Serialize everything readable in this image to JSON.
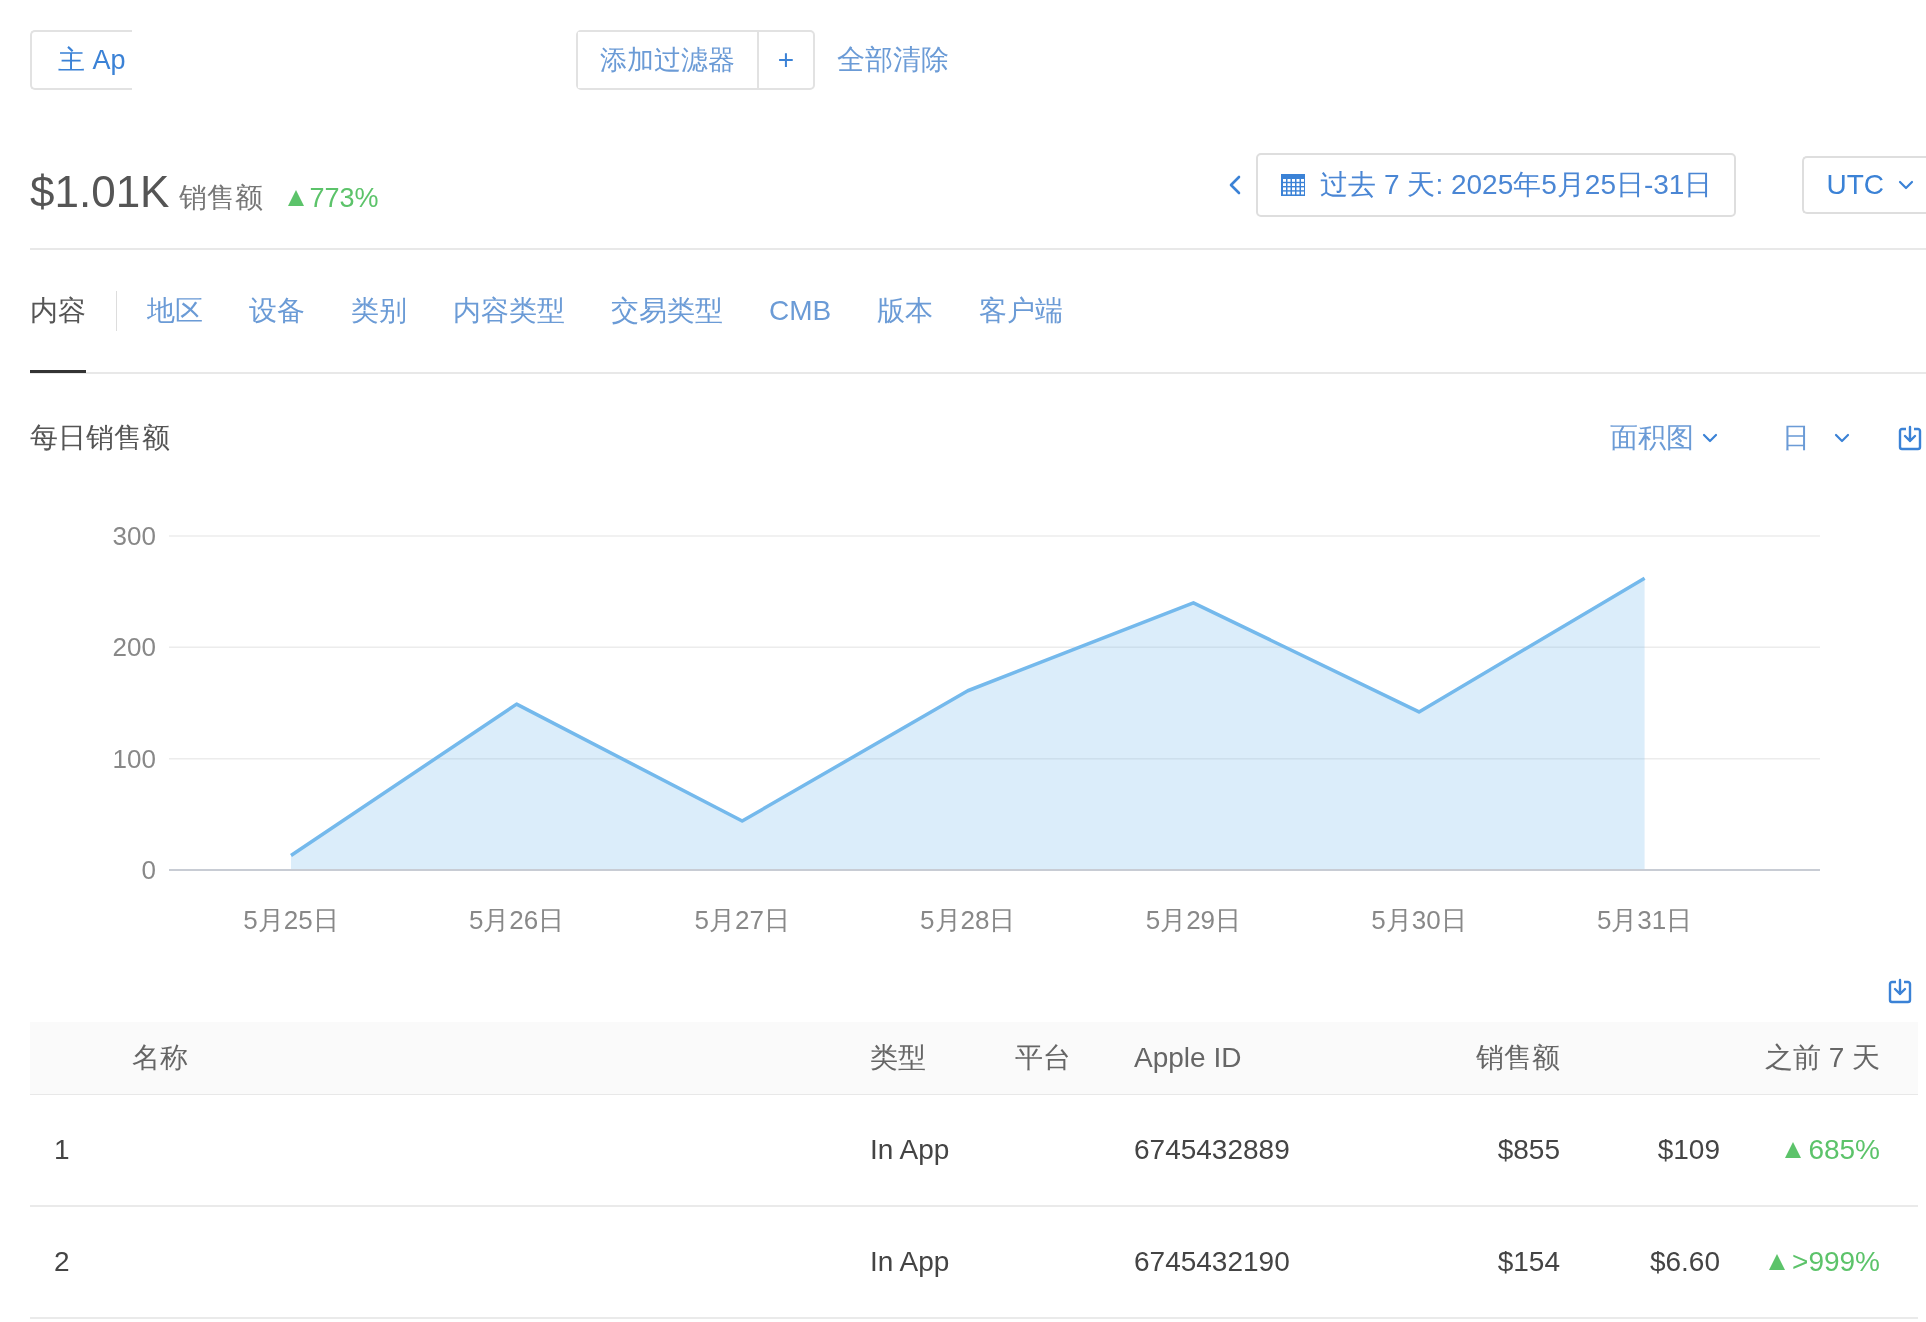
{
  "filter_bar": {
    "app_filter": "主 Ap",
    "add_filter": "添加过滤器",
    "add_icon": "+",
    "clear_all": "全部清除"
  },
  "summary": {
    "total": "$1.01K",
    "label": "销售额",
    "change": "773%",
    "rising": true
  },
  "date_range": {
    "label": "过去 7 天: 2025年5月25日-31日"
  },
  "timezone": {
    "value": "UTC"
  },
  "tabs": [
    {
      "label": "内容",
      "selected": true
    },
    {
      "label": "地区",
      "selected": false
    },
    {
      "label": "设备",
      "selected": false
    },
    {
      "label": "类别",
      "selected": false
    },
    {
      "label": "内容类型",
      "selected": false
    },
    {
      "label": "交易类型",
      "selected": false
    },
    {
      "label": "CMB",
      "selected": false
    },
    {
      "label": "版本",
      "selected": false
    },
    {
      "label": "客户端",
      "selected": false
    }
  ],
  "chart_panel": {
    "title": "每日销售额",
    "chart_type": "面积图",
    "interval": "日",
    "chart_data": {
      "type": "area",
      "categories": [
        "5月25日",
        "5月26日",
        "5月27日",
        "5月28日",
        "5月29日",
        "5月30日",
        "5月31日"
      ],
      "series": [
        {
          "color": "#74b9ec",
          "values": [
            13,
            149,
            44,
            161,
            240,
            142,
            262
          ]
        }
      ],
      "ylim": [
        0,
        300
      ],
      "yticks": [
        0,
        100,
        200,
        300
      ]
    }
  },
  "table": {
    "columns": [
      "名称",
      "类型",
      "平台",
      "Apple ID",
      "销售额",
      "之前 7 天"
    ],
    "rows": [
      {
        "rank": "1",
        "type": "In App",
        "apple_id": "6745432889",
        "sales": "$855",
        "previous": "$109",
        "change": "685%",
        "rising": true
      },
      {
        "rank": "2",
        "type": "In App",
        "apple_id": "6745432190",
        "sales": "$154",
        "previous": "$6.60",
        "change": ">999%",
        "rising": true
      }
    ]
  }
}
